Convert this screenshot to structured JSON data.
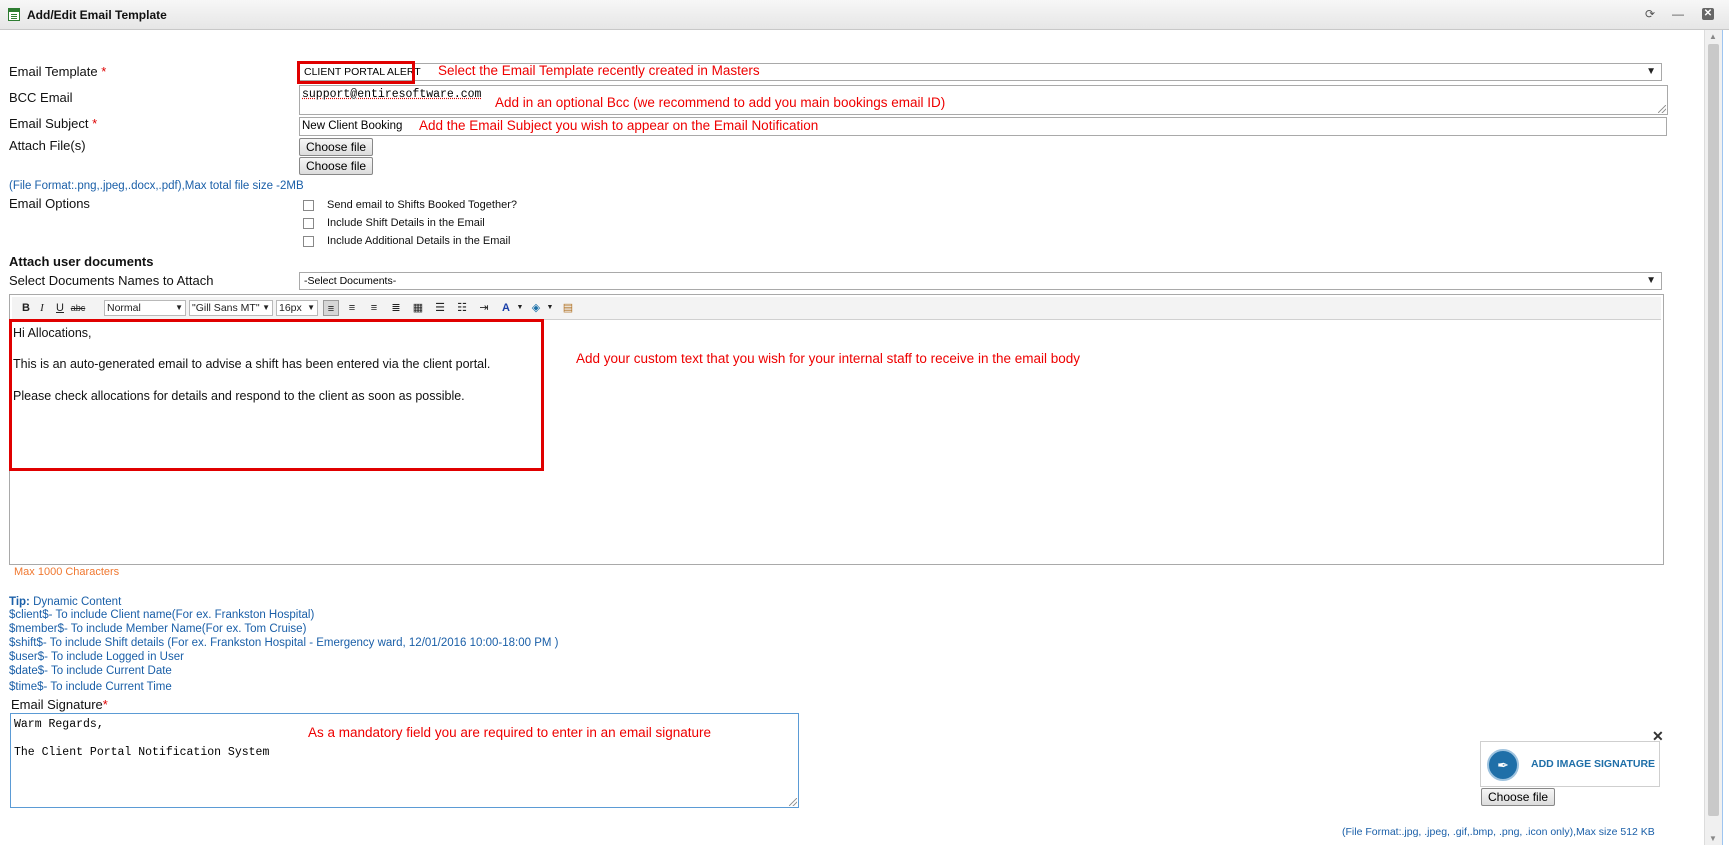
{
  "window": {
    "title": "Add/Edit Email Template",
    "refresh_icon": "refresh-icon",
    "minimize_icon": "minimize-icon",
    "close_icon": "close-icon"
  },
  "form": {
    "email_template": {
      "label": "Email Template",
      "required": "*",
      "value": "CLIENT PORTAL ALERT",
      "note": "Select the Email Template recently created in Masters"
    },
    "bcc_email": {
      "label": "BCC Email",
      "value": "support@entiresoftware.com",
      "note": "Add in an optional Bcc (we recommend to add you main bookings email ID)"
    },
    "email_subject": {
      "label": "Email Subject",
      "required": "*",
      "value": "New Client Booking",
      "note": "Add the Email Subject you wish to appear on the Email Notification"
    },
    "attach_files": {
      "label": "Attach File(s)",
      "button1": "Choose file",
      "button2": "Choose file",
      "format_note": "(File Format:.png,.jpeg,.docx,.pdf),Max total file size -2MB"
    },
    "email_options": {
      "label": "Email Options",
      "options": [
        "Send email to Shifts Booked Together?",
        "Include Shift Details in the Email",
        "Include Additional Details in the Email"
      ]
    },
    "attach_user_documents": {
      "heading": "Attach user documents",
      "label": "Select Documents Names to Attach",
      "placeholder": "-Select Documents-"
    },
    "editor": {
      "toolbar": {
        "format": "Normal",
        "font": "\"Gill Sans MT\"",
        "size": "16px"
      },
      "lines": [
        "Hi Allocations,",
        "This is an auto-generated email to advise a shift has been entered via the client portal.",
        "Please check allocations for details and respond to the client as soon as possible."
      ],
      "note": "Add your custom text that you wish for your internal staff to receive in the email body",
      "max_chars": "Max 1000 Characters"
    },
    "tips": {
      "title": "Tip:",
      "title_rest": " Dynamic Content",
      "items": [
        "$client$- To include Client name(For ex. Frankston Hospital)",
        "$member$- To include Member Name(For ex. Tom Cruise)",
        "$shift$- To include Shift details (For ex. Frankston Hospital - Emergency ward, 12/01/2016 10:00-18:00 PM )",
        "$user$- To include Logged in User",
        "$date$- To include Current Date",
        "$time$- To include Current Time"
      ]
    },
    "signature": {
      "label": "Email Signature",
      "required": "*",
      "line1": "Warm Regards,",
      "line2": "The Client Portal Notification System",
      "note": "As a mandatory field you are required to enter in an email signature"
    },
    "image_signature": {
      "label": "ADD IMAGE SIGNATURE",
      "button": "Choose file",
      "remove": "✕",
      "format_note": "(File Format:.jpg, .jpeg, .gif,.bmp, .png, .icon only),Max size 512 KB"
    }
  },
  "colors": {
    "annotation_red": "#e00000",
    "tip_blue": "#1a5fa8",
    "max_chars_orange": "#f07830"
  }
}
